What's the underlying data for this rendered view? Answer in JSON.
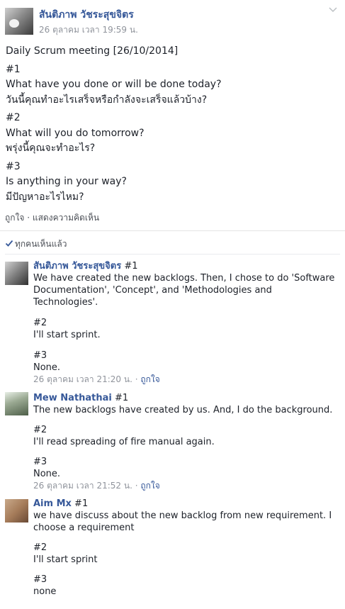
{
  "post": {
    "author": "สันติภาพ วัชระสุขจิตร",
    "timestamp": "26 ตุลาคม เวลา 19:59 น.",
    "lines": [
      "Daily Scrum meeting [26/10/2014]",
      "#1",
      "What have you done or will be done today?",
      "วันนี้คุณทำอะไรเสร็จหรือกำลังจะเสร็จแล้วบ้าง?",
      "#2",
      "What will you do tomorrow?",
      "พรุ่งนี้คุณจะทำอะไร?",
      "#3",
      "Is anything in your way?",
      "มีปัญหาอะไรไหม?"
    ],
    "actions": {
      "like": "ถูกใจ",
      "sep": " · ",
      "comment": "แสดงความคิดเห็น"
    }
  },
  "seen": {
    "label": "ทุกคนเห็นแล้ว"
  },
  "comments": [
    {
      "name": "สันติภาพ วัชระสุขจิตร",
      "text1": " #1",
      "text1b": "We have created the new backlogs. Then, I chose to do 'Software",
      "text1c": "Documentation', 'Concept', and 'Methodologies and",
      "text1d": "Technologies'.",
      "h2": "#2",
      "t2": "I'll start sprint.",
      "h3": "#3",
      "t3": "None.",
      "time": "26 ตุลาคม เวลา 21:20 น.",
      "sep": " · ",
      "like": "ถูกใจ"
    },
    {
      "name": "Mew Nathathai",
      "text1": " #1",
      "text1b": "The new backlogs have created by us. And, I do the background.",
      "h2": "#2",
      "t2": "I'll read spreading of fire manual again.",
      "h3": "#3",
      "t3": "None.",
      "time": "26 ตุลาคม เวลา 21:52 น.",
      "sep": " · ",
      "like": "ถูกใจ"
    },
    {
      "name": "Aim Mx",
      "text1": " #1",
      "text1b": "we have discuss about the new backlog from new requirement. I",
      "text1c": "choose a requirement",
      "h2": "#2",
      "t2": "I'll start sprint",
      "h3": "#3",
      "t3": "none"
    }
  ]
}
